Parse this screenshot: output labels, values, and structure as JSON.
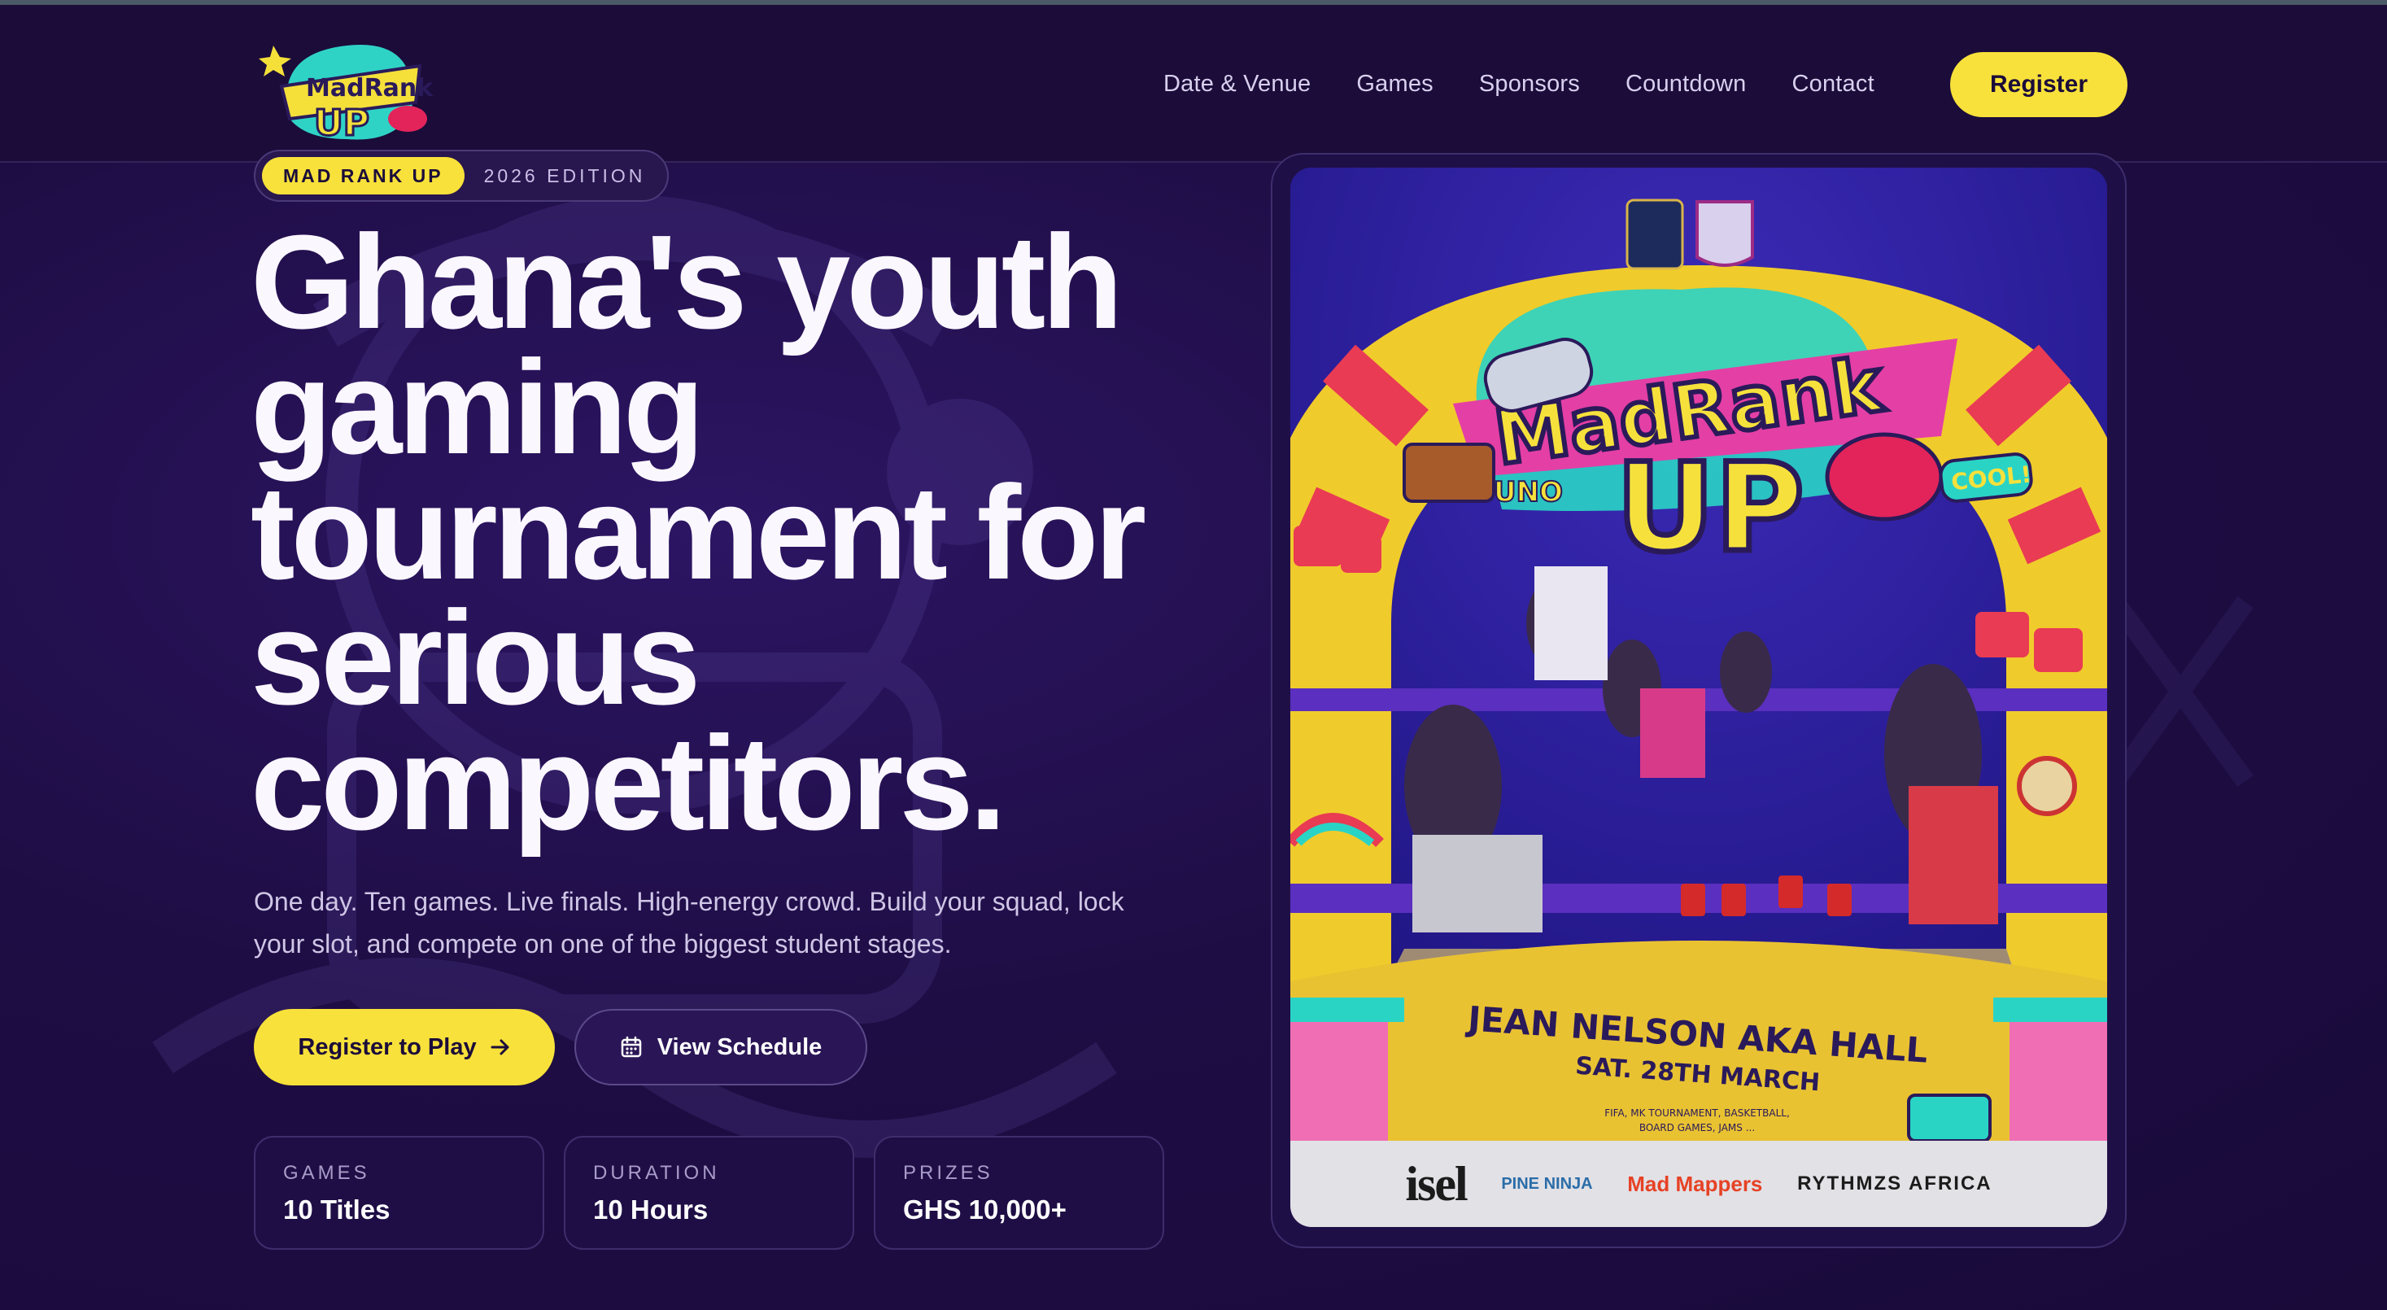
{
  "nav": {
    "logo_alt": "MadRank UP",
    "links": [
      "Date & Venue",
      "Games",
      "Sponsors",
      "Countdown",
      "Contact"
    ],
    "register_label": "Register"
  },
  "hero": {
    "edition_tag": "MAD RANK UP",
    "edition_text": "2026 EDITION",
    "title": "Ghana's youth gaming tournament for serious competitors.",
    "subtitle": "One day. Ten games. Live finals. High-energy crowd. Build your squad, lock your slot, and compete on one of the biggest student stages.",
    "primary_cta": "Register to Play",
    "secondary_cta": "View Schedule"
  },
  "stats": [
    {
      "label": "GAMES",
      "value": "10 Titles"
    },
    {
      "label": "DURATION",
      "value": "10 Hours"
    },
    {
      "label": "PRIZES",
      "value": "GHS 10,000+"
    }
  ],
  "poster": {
    "logo_top": "MadRank",
    "logo_bottom": "UP",
    "logo_uno": "UNO",
    "logo_cool": "COOL!",
    "venue": "JEAN NELSON AKA HALL",
    "date": "SAT. 28TH MARCH",
    "events": "FIFA, MK TOURNAMENT, BASKETBALL,",
    "events2": "BOARD GAMES, JAMS ...",
    "sponsors": [
      "isel",
      "PINE NINJA",
      "Mad Mappers",
      "RYTHMZS AFRICA"
    ]
  },
  "colors": {
    "accent": "#f8e13a",
    "background": "#1d0e3f",
    "card": "#1e0e45"
  }
}
